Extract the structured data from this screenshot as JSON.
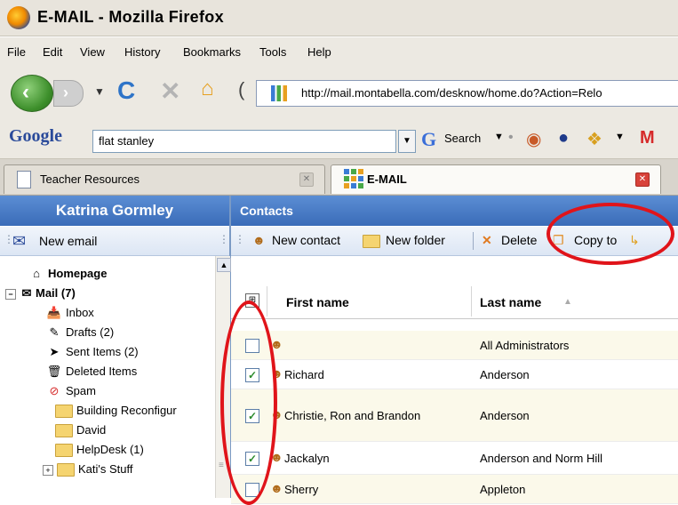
{
  "window": {
    "title": "E-MAIL - Mozilla Firefox"
  },
  "menu": [
    "File",
    "Edit",
    "View",
    "History",
    "Bookmarks",
    "Tools",
    "Help"
  ],
  "nav": {
    "url": "http://mail.montabella.com/desknow/home.do?Action=Relo"
  },
  "search": {
    "engine": "Google",
    "query": "flat stanley",
    "button_label": "Search"
  },
  "tabs": [
    {
      "label": "Teacher Resources"
    },
    {
      "label": "E-MAIL"
    }
  ],
  "sidebar": {
    "user_name": "Katrina Gormley",
    "new_email_label": "New email",
    "tree": [
      {
        "label": "Homepage",
        "icon": "home-icon"
      },
      {
        "label": "Mail (7)",
        "icon": "mail-icon"
      },
      {
        "label": "Inbox",
        "icon": "inbox-icon"
      },
      {
        "label": "Drafts (2)",
        "icon": "drafts-icon"
      },
      {
        "label": "Sent Items (2)",
        "icon": "sent-icon"
      },
      {
        "label": "Deleted Items",
        "icon": "trash-icon"
      },
      {
        "label": "Spam",
        "icon": "spam-icon"
      },
      {
        "label": "Building Reconfigur",
        "icon": "folder-icon"
      },
      {
        "label": "David",
        "icon": "folder-icon"
      },
      {
        "label": "HelpDesk (1)",
        "icon": "folder-icon"
      },
      {
        "label": "Kati's Stuff",
        "icon": "folder-icon"
      }
    ]
  },
  "main": {
    "header": "Contacts",
    "toolbar": {
      "new_contact": "New contact",
      "new_folder": "New folder",
      "delete": "Delete",
      "copy_to": "Copy to"
    },
    "columns": {
      "first_name": "First name",
      "last_name": "Last name"
    },
    "rows": [
      {
        "first": "",
        "last": "All Administrators",
        "checked": false
      },
      {
        "first": "Richard",
        "last": "Anderson",
        "checked": true
      },
      {
        "first": "Christie, Ron and Brandon",
        "last": "Anderson",
        "checked": true
      },
      {
        "first": "Jackalyn",
        "last": "Anderson and Norm Hill",
        "checked": true
      },
      {
        "first": "Sherry",
        "last": "Appleton",
        "checked": false
      }
    ]
  },
  "colors": {
    "header_blue": "#4a7cc7",
    "annotation_red": "#e0141a",
    "row_alt": "#fbf9ea"
  }
}
